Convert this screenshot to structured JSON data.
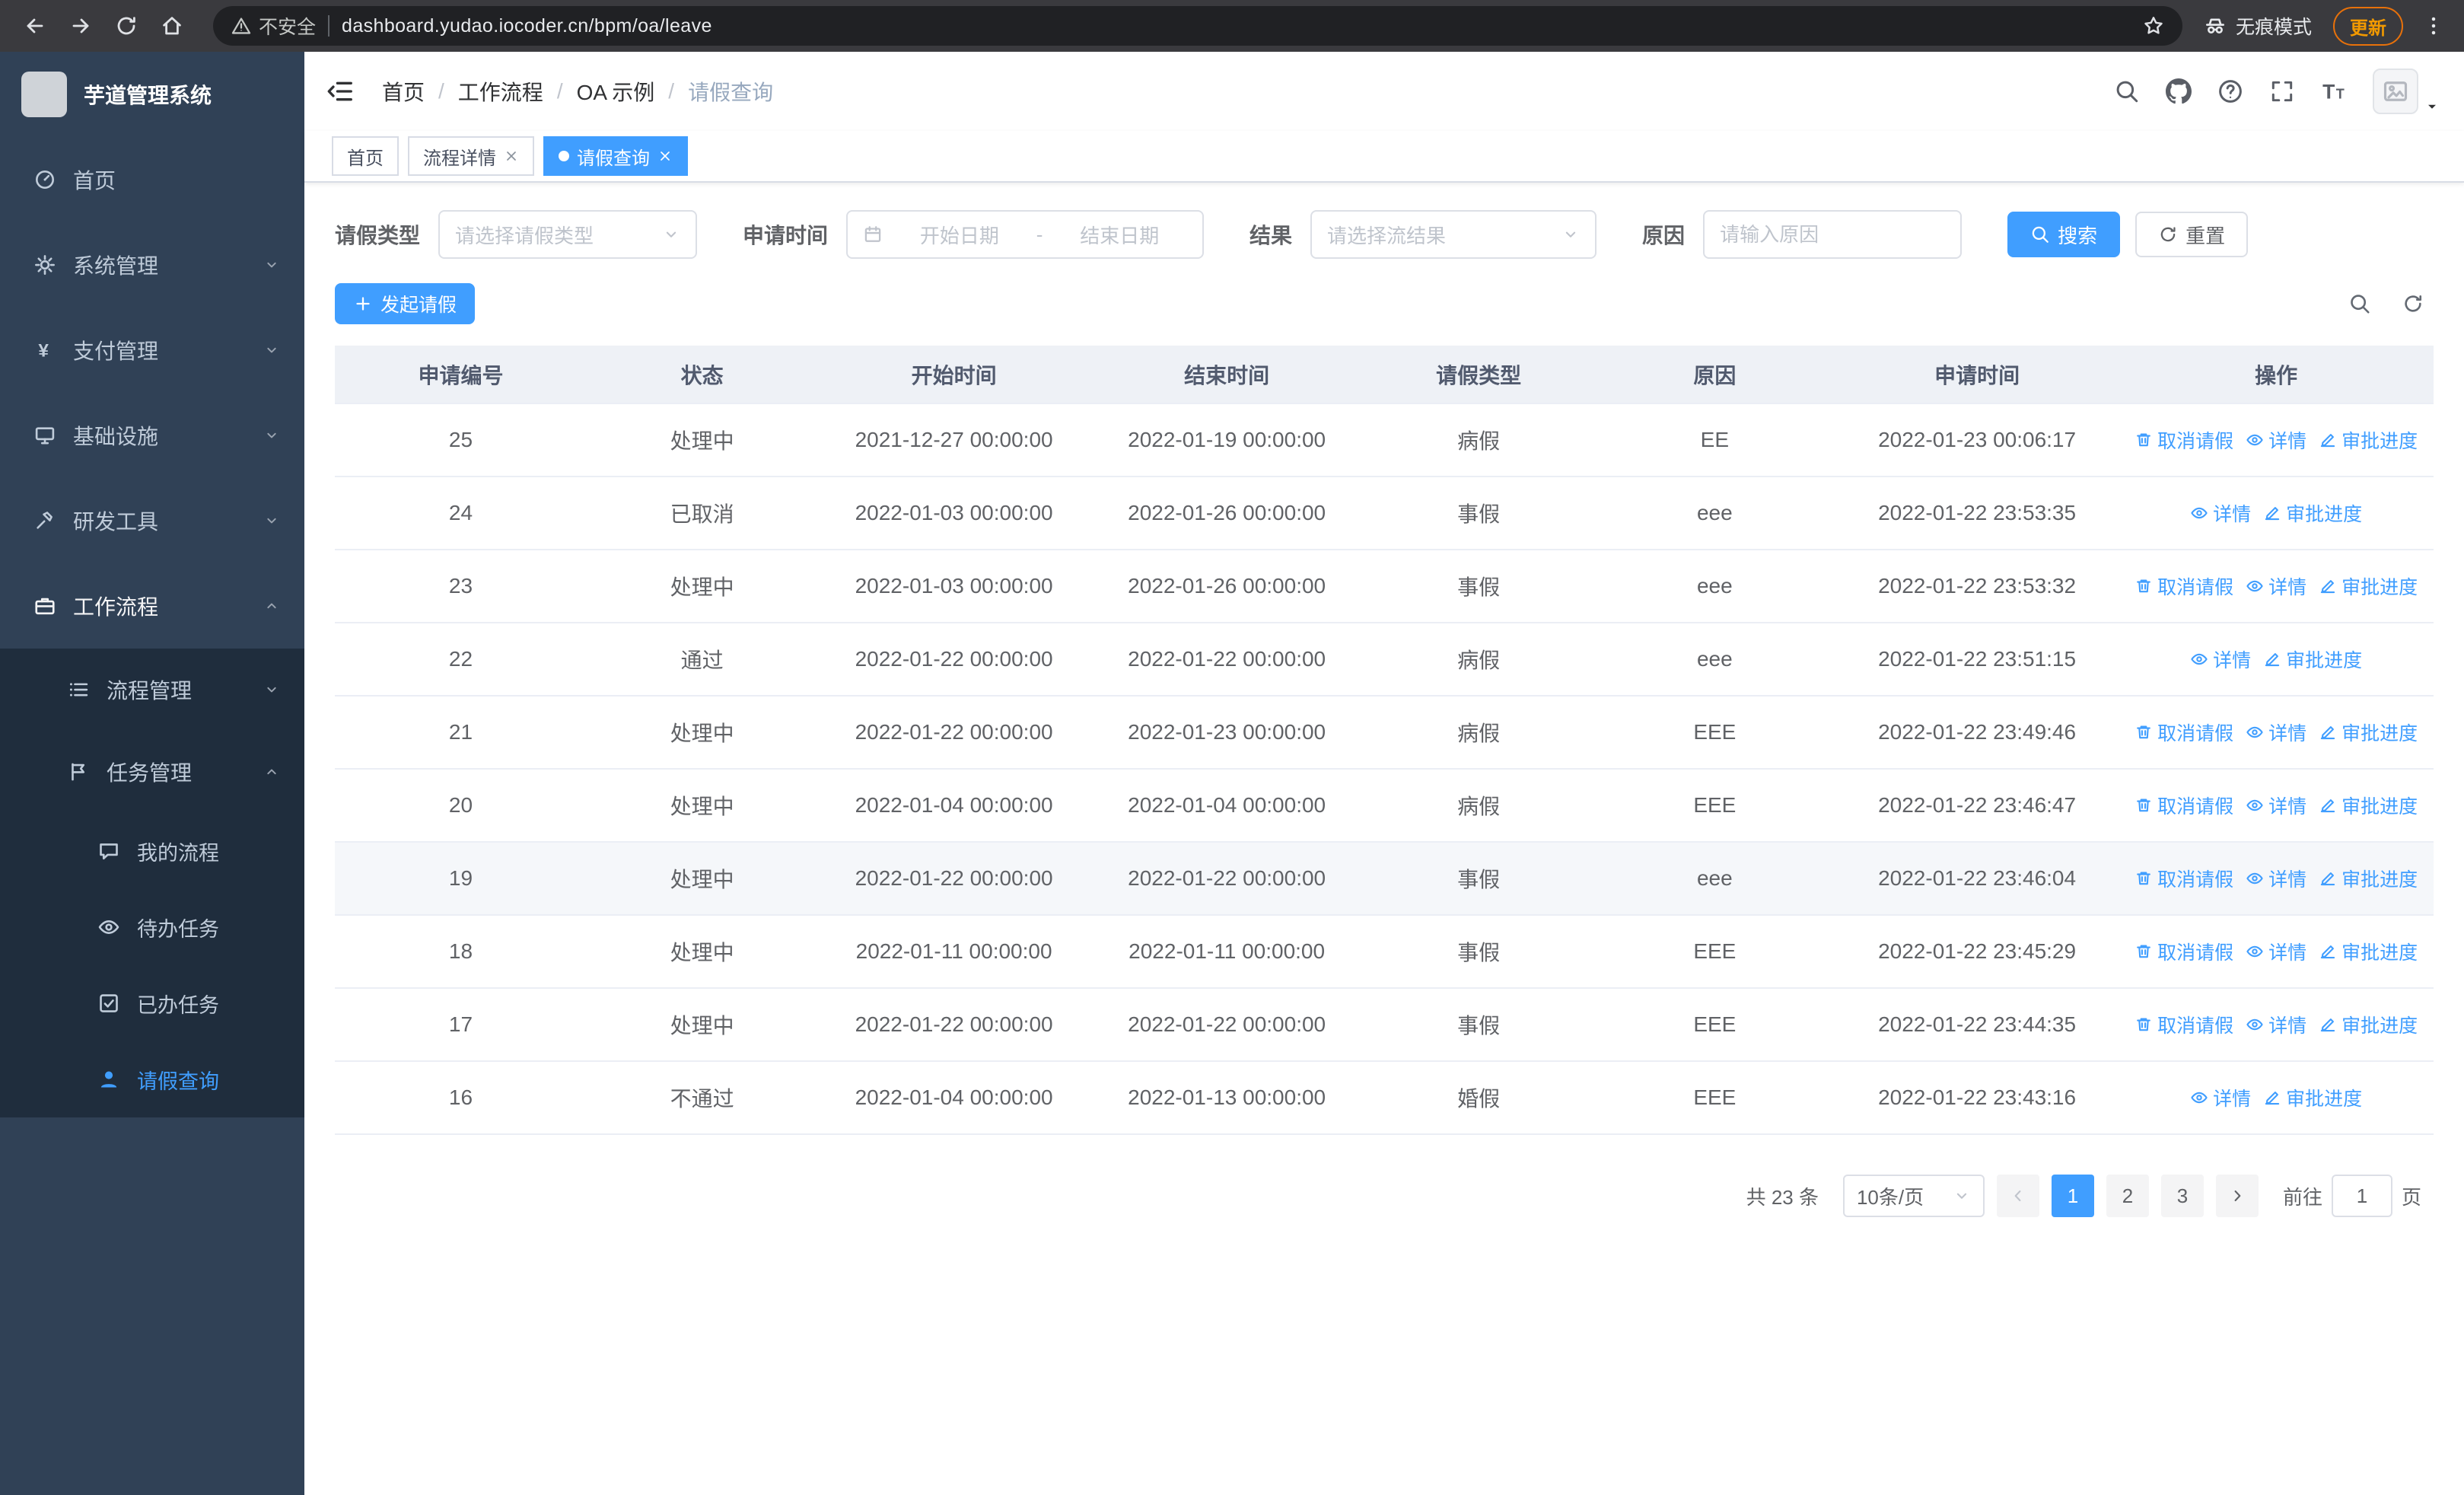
{
  "browser": {
    "security_label": "不安全",
    "url": "dashboard.yudao.iocoder.cn/bpm/oa/leave",
    "incognito_label": "无痕模式",
    "update_label": "更新"
  },
  "sidebar": {
    "logo_title": "芋道管理系统",
    "items": [
      {
        "label": "首页"
      },
      {
        "label": "系统管理"
      },
      {
        "label": "支付管理"
      },
      {
        "label": "基础设施"
      },
      {
        "label": "研发工具"
      },
      {
        "label": "工作流程"
      }
    ],
    "sub_items": [
      {
        "label": "流程管理"
      },
      {
        "label": "任务管理"
      }
    ],
    "task_items": [
      {
        "label": "我的流程"
      },
      {
        "label": "待办任务"
      },
      {
        "label": "已办任务"
      },
      {
        "label": "请假查询"
      }
    ]
  },
  "header": {
    "breadcrumb": [
      "首页",
      "工作流程",
      "OA 示例",
      "请假查询"
    ]
  },
  "tabs": [
    {
      "label": "首页"
    },
    {
      "label": "流程详情"
    },
    {
      "label": "请假查询"
    }
  ],
  "filters": {
    "leave_type_label": "请假类型",
    "leave_type_placeholder": "请选择请假类型",
    "apply_time_label": "申请时间",
    "start_date_placeholder": "开始日期",
    "date_separator": "-",
    "end_date_placeholder": "结束日期",
    "result_label": "结果",
    "result_placeholder": "请选择流结果",
    "reason_label": "原因",
    "reason_placeholder": "请输入原因",
    "search_button": "搜索",
    "reset_button": "重置"
  },
  "toolbar": {
    "create_button": "发起请假"
  },
  "table": {
    "columns": [
      "申请编号",
      "状态",
      "开始时间",
      "结束时间",
      "请假类型",
      "原因",
      "申请时间",
      "操作"
    ],
    "actions": {
      "cancel": "取消请假",
      "detail": "详情",
      "progress": "审批进度"
    },
    "action_icons": {
      "cancel": "trash-icon",
      "detail": "view-icon",
      "progress": "edit-icon"
    },
    "rows": [
      {
        "id": "25",
        "status": "处理中",
        "start": "2021-12-27 00:00:00",
        "end": "2022-01-19 00:00:00",
        "type": "病假",
        "reason": "EE",
        "applied": "2022-01-23 00:06:17",
        "cancellable": true
      },
      {
        "id": "24",
        "status": "已取消",
        "start": "2022-01-03 00:00:00",
        "end": "2022-01-26 00:00:00",
        "type": "事假",
        "reason": "eee",
        "applied": "2022-01-22 23:53:35",
        "cancellable": false
      },
      {
        "id": "23",
        "status": "处理中",
        "start": "2022-01-03 00:00:00",
        "end": "2022-01-26 00:00:00",
        "type": "事假",
        "reason": "eee",
        "applied": "2022-01-22 23:53:32",
        "cancellable": true
      },
      {
        "id": "22",
        "status": "通过",
        "start": "2022-01-22 00:00:00",
        "end": "2022-01-22 00:00:00",
        "type": "病假",
        "reason": "eee",
        "applied": "2022-01-22 23:51:15",
        "cancellable": false
      },
      {
        "id": "21",
        "status": "处理中",
        "start": "2022-01-22 00:00:00",
        "end": "2022-01-23 00:00:00",
        "type": "病假",
        "reason": "EEE",
        "applied": "2022-01-22 23:49:46",
        "cancellable": true
      },
      {
        "id": "20",
        "status": "处理中",
        "start": "2022-01-04 00:00:00",
        "end": "2022-01-04 00:00:00",
        "type": "病假",
        "reason": "EEE",
        "applied": "2022-01-22 23:46:47",
        "cancellable": true
      },
      {
        "id": "19",
        "status": "处理中",
        "start": "2022-01-22 00:00:00",
        "end": "2022-01-22 00:00:00",
        "type": "事假",
        "reason": "eee",
        "applied": "2022-01-22 23:46:04",
        "cancellable": true,
        "highlighted": true
      },
      {
        "id": "18",
        "status": "处理中",
        "start": "2022-01-11 00:00:00",
        "end": "2022-01-11 00:00:00",
        "type": "事假",
        "reason": "EEE",
        "applied": "2022-01-22 23:45:29",
        "cancellable": true
      },
      {
        "id": "17",
        "status": "处理中",
        "start": "2022-01-22 00:00:00",
        "end": "2022-01-22 00:00:00",
        "type": "事假",
        "reason": "EEE",
        "applied": "2022-01-22 23:44:35",
        "cancellable": true
      },
      {
        "id": "16",
        "status": "不通过",
        "start": "2022-01-04 00:00:00",
        "end": "2022-01-13 00:00:00",
        "type": "婚假",
        "reason": "EEE",
        "applied": "2022-01-22 23:43:16",
        "cancellable": false
      }
    ]
  },
  "pagination": {
    "total_text": "共 23 条",
    "page_size": "10条/页",
    "pages": [
      "1",
      "2",
      "3"
    ],
    "active_page": "1",
    "goto_label": "前往",
    "goto_value": "1",
    "goto_unit": "页"
  },
  "colors": {
    "primary": "#409eff",
    "sidebar_bg": "#304156",
    "submenu_bg": "#1f2d3d",
    "update_accent": "#f29900"
  }
}
